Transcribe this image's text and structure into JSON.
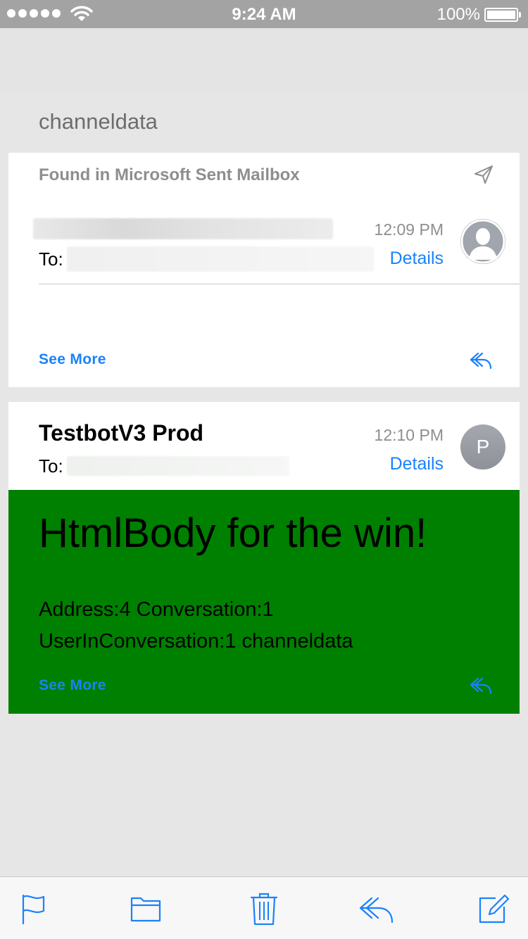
{
  "status_bar": {
    "time": "9:24 AM",
    "battery_percent": "100%",
    "signal_icon": "signal-dots-icon",
    "wifi_icon": "wifi-icon",
    "battery_icon": "battery-icon"
  },
  "thread": {
    "subject": "channeldata"
  },
  "messages": [
    {
      "mailbox_note": "Found in Microsoft Sent Mailbox",
      "sender": "",
      "to_label": "To:",
      "time": "12:09 PM",
      "details_label": "Details",
      "see_more_label": "See More",
      "avatar_initial": ""
    },
    {
      "sender": "TestbotV3 Prod",
      "to_label": "To:",
      "time": "12:10 PM",
      "details_label": "Details",
      "avatar_initial": "P",
      "html_body": {
        "heading": "HtmlBody for the win!",
        "paragraph": "Address:4 Conversation:1 UserInConversation:1 channeldata",
        "background_color": "#008000"
      },
      "see_more_label": "See More"
    }
  ],
  "toolbar": {
    "items": [
      "flag-icon",
      "folder-icon",
      "trash-icon",
      "reply-icon",
      "compose-icon"
    ]
  },
  "colors": {
    "accent": "#1a82fb",
    "status_bar_bg": "#a3a3a3",
    "html_body_bg": "#008000"
  }
}
